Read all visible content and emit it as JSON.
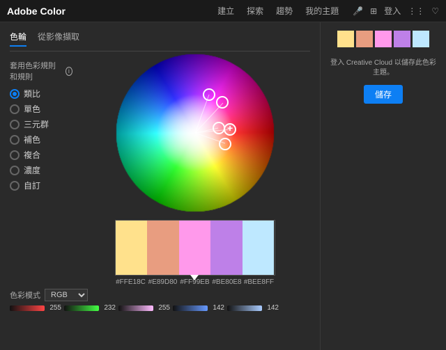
{
  "header": {
    "logo": "Adobe Color",
    "nav": [
      "建立",
      "探索",
      "趨勢",
      "我的主題"
    ],
    "login": "登入",
    "icons": [
      "mic",
      "grid",
      "apps"
    ]
  },
  "tabs": [
    "色輪",
    "從影像擷取"
  ],
  "rules_label": "套用色彩規則和規則",
  "radio_options": [
    {
      "label": "類比",
      "active": true
    },
    {
      "label": "單色",
      "active": false
    },
    {
      "label": "三元群",
      "active": false
    },
    {
      "label": "補色",
      "active": false
    },
    {
      "label": "複合",
      "active": false
    },
    {
      "label": "濃度",
      "active": false
    },
    {
      "label": "自訂",
      "active": false
    }
  ],
  "swatches": [
    {
      "color": "#FFE18C",
      "hex": "#FFE18C",
      "active_arrow": false
    },
    {
      "color": "#E89D80",
      "hex": "#E89D80",
      "active_arrow": false
    },
    {
      "color": "#FF99EB",
      "hex": "#FF99EB",
      "active_arrow": true
    },
    {
      "color": "#BE80E8",
      "hex": "#BE80E8",
      "active_arrow": false
    },
    {
      "color": "#BEE8FF",
      "hex": "#BEE8FF",
      "active_arrow": false
    }
  ],
  "color_mode": {
    "label": "色彩模式",
    "value": "RGB"
  },
  "rgb_channels": [
    {
      "color_start": "#000",
      "color_end": "#ff0000",
      "value": "255"
    },
    {
      "color_start": "#000",
      "color_end": "#00ff00",
      "value": "232"
    },
    {
      "color_start": "#000",
      "color_end": "#0000ff",
      "value": "255"
    },
    {
      "color_start": "#000",
      "color_end": "#00aaff",
      "value": "142"
    },
    {
      "color_start": "#000",
      "color_end": "#88aaff",
      "value": "142"
    }
  ],
  "right_panel": {
    "save_text": "登入 Creative Cloud 以儲存此色彩主題。",
    "save_button": "儲存"
  },
  "mini_swatches": [
    "#FFE18C",
    "#E89D80",
    "#FF99EB",
    "#BE80E8",
    "#BEE8FF"
  ]
}
